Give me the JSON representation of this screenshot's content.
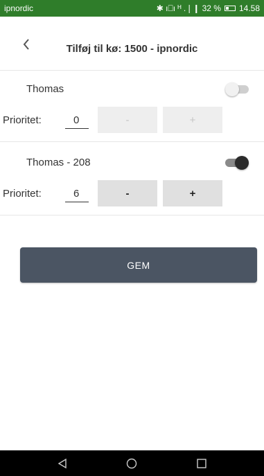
{
  "status_bar": {
    "carrier": "ipnordic",
    "signal_text": "✱ ı⎕ı ᴴ .❘❙ 32 %",
    "time": "14.58"
  },
  "header": {
    "title": "Tilføj til kø: 1500 - ipnordic"
  },
  "rows": [
    {
      "name": "Thomas",
      "enabled": false,
      "priority_label": "Prioritet:",
      "priority_value": "0",
      "minus_label": "-",
      "plus_label": "+"
    },
    {
      "name": "Thomas - 208",
      "enabled": true,
      "priority_label": "Prioritet:",
      "priority_value": "6",
      "minus_label": "-",
      "plus_label": "+"
    }
  ],
  "save_label": "GEM",
  "colors": {
    "status_bar": "#2f7d2a",
    "save_button": "#4b5563",
    "nav_bar": "#000000"
  },
  "icons": {
    "back": "chevron-left-icon",
    "nav_back": "triangle-back-icon",
    "nav_home": "circle-home-icon",
    "nav_recents": "square-recents-icon"
  }
}
